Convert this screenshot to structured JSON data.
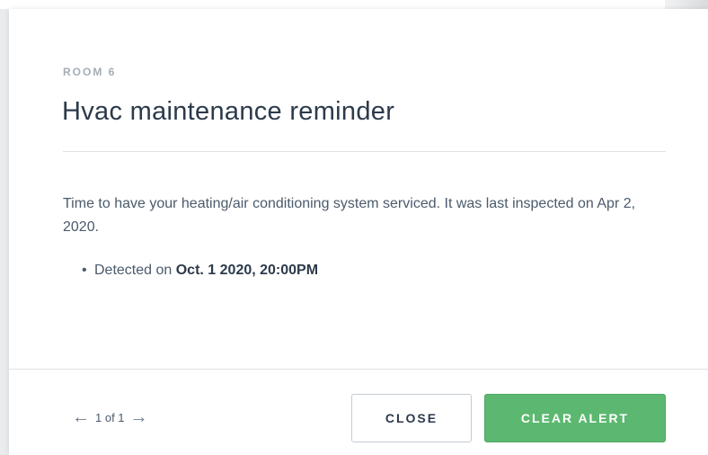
{
  "alert": {
    "room": "ROOM 6",
    "title": "Hvac maintenance reminder",
    "message": "Time to have your heating/air conditioning system serviced. It was last inspected on Apr 2, 2020.",
    "bullet_symbol": "•",
    "detected_label": "Detected on",
    "detected_value": "Oct. 1 2020, 20:00PM"
  },
  "footer": {
    "prev_icon": "arrow-left-icon",
    "prev_symbol": "←",
    "pager_text": "1 of 1",
    "next_icon": "arrow-right-icon",
    "next_symbol": "→",
    "close_label": "CLOSE",
    "clear_label": "CLEAR ALERT"
  },
  "colors": {
    "primary_green": "#5cb870",
    "title_text": "#2c3a4b",
    "muted_label": "#a4adb8"
  }
}
